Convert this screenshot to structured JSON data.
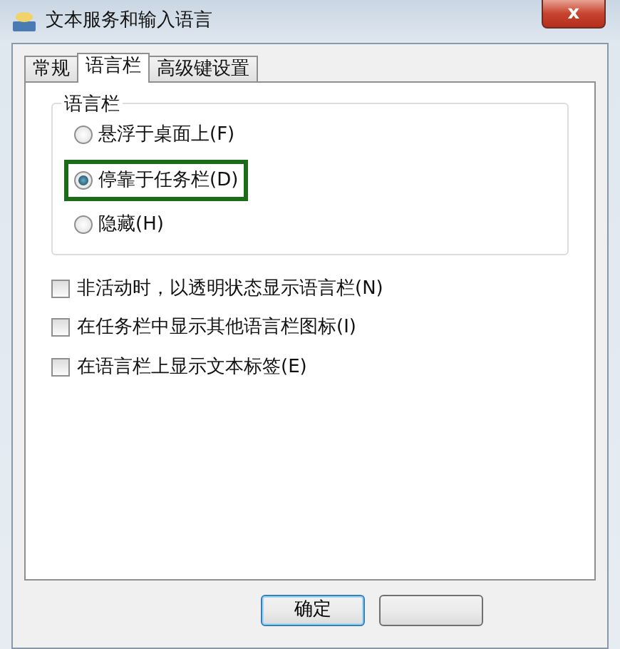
{
  "window": {
    "title": "文本服务和输入语言",
    "close": "x"
  },
  "tabs": [
    {
      "label": "常规",
      "selected": false
    },
    {
      "label": "语言栏",
      "selected": true
    },
    {
      "label": "高级键设置",
      "selected": false
    }
  ],
  "group": {
    "title": "语言栏",
    "options": [
      {
        "label": "悬浮于桌面上(F)",
        "selected": false,
        "highlighted": false
      },
      {
        "label": "停靠于任务栏(D)",
        "selected": true,
        "highlighted": true
      },
      {
        "label": "隐藏(H)",
        "selected": false,
        "highlighted": false
      }
    ]
  },
  "checkboxes": [
    {
      "label": "非活动时，以透明状态显示语言栏(N)",
      "checked": false
    },
    {
      "label": "在任务栏中显示其他语言栏图标(I)",
      "checked": false
    },
    {
      "label": "在语言栏上显示文本标签(E)",
      "checked": false
    }
  ],
  "buttons": [
    {
      "kind": "text",
      "label": "确定"
    },
    {
      "kind": "blank"
    }
  ]
}
